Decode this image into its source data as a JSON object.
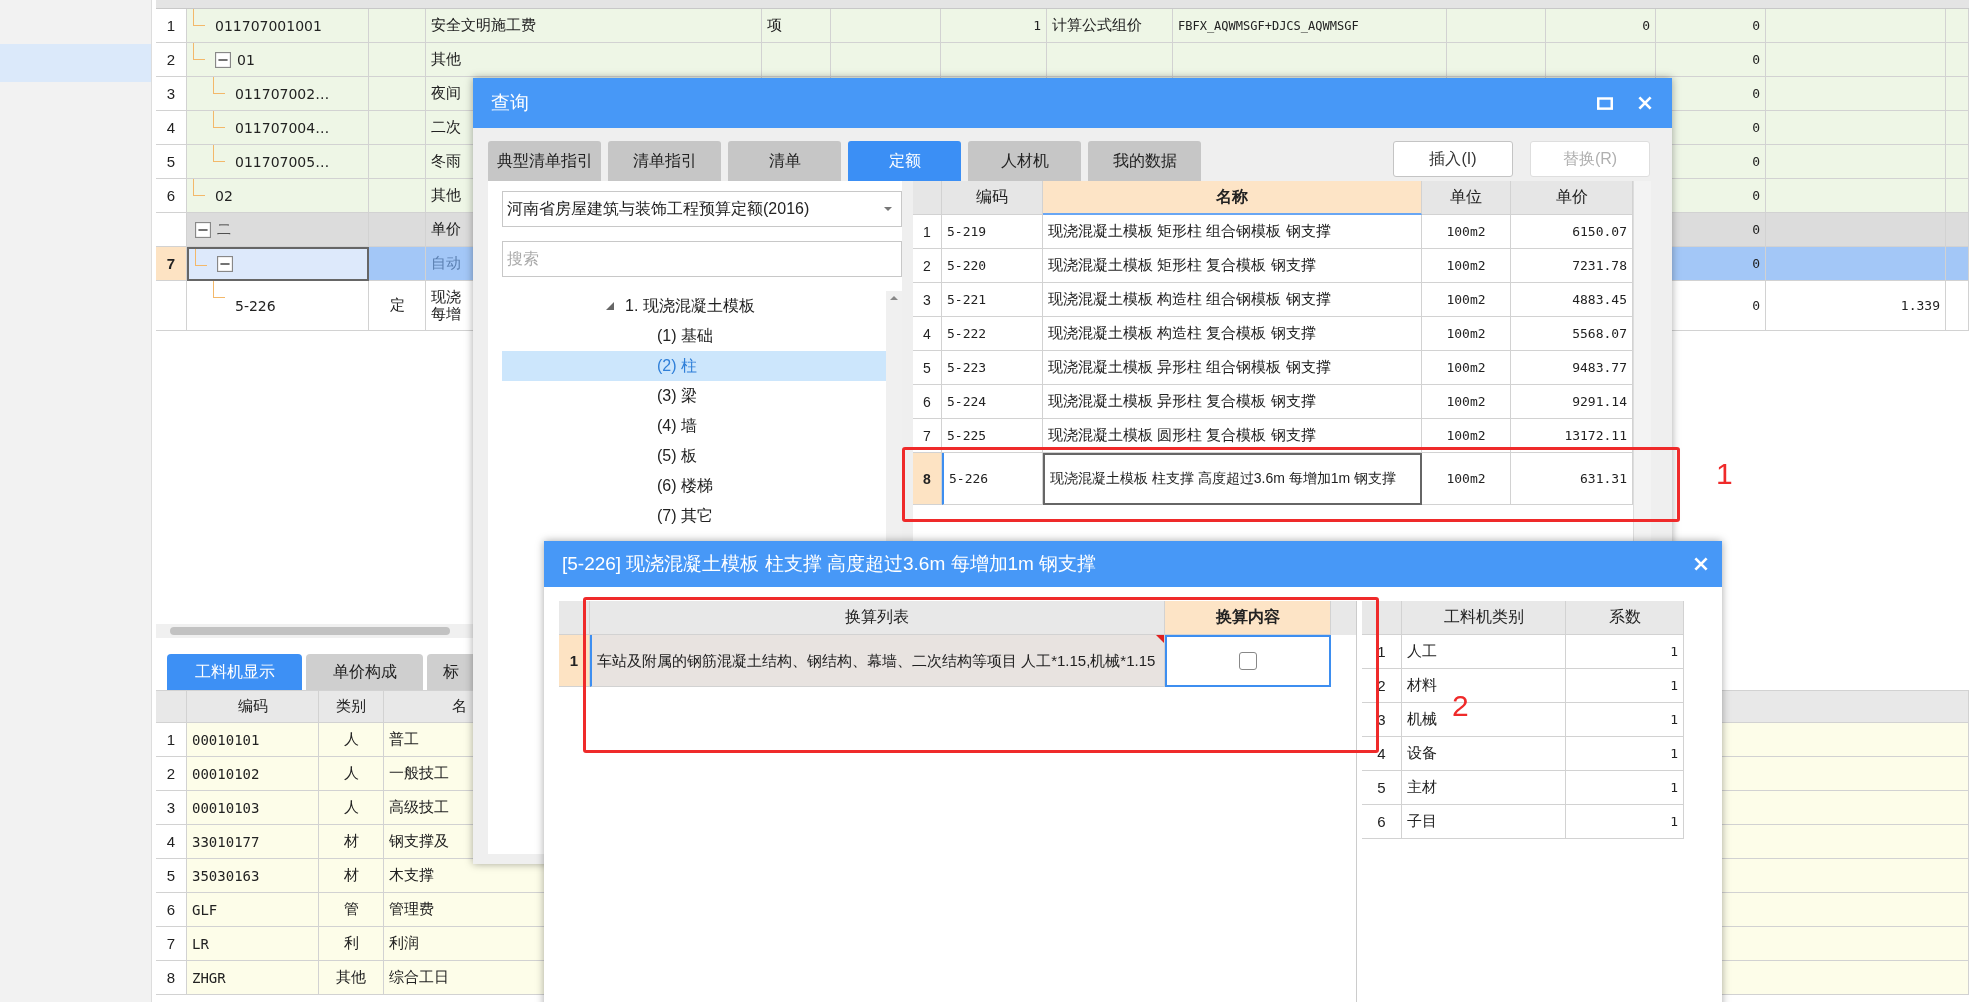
{
  "sidebar": {
    "items": [
      {
        "selected": true
      }
    ]
  },
  "main_table": {
    "rows": [
      {
        "kind": "measure",
        "number": "1",
        "code": "011707001001",
        "name": "安全文明施工费",
        "unit": "项",
        "quantity": "1",
        "method": "计算公式组价",
        "formula": "FBFX_AQWMSGF+DJCS_AQWMSGF",
        "value_1": "0",
        "value_2": "0"
      },
      {
        "kind": "measure",
        "number": "2",
        "code": "01",
        "expanded": true,
        "name": "其他",
        "value_2": "0",
        "children": [
          {
            "kind": "measure",
            "number": "3",
            "code": "011707002…",
            "name": "夜间",
            "value_2": "0"
          },
          {
            "kind": "measure",
            "number": "4",
            "code": "011707004…",
            "name": "二次",
            "value_2": "0"
          },
          {
            "kind": "measure",
            "number": "5",
            "code": "011707005…",
            "name": "冬雨",
            "value_2": "0"
          }
        ]
      },
      {
        "kind": "measure",
        "number": "6",
        "code": "02",
        "name": "其他",
        "value_2": "0"
      },
      {
        "kind": "section",
        "code": "二",
        "expanded": true,
        "name": "单价",
        "value_2": "0",
        "children": [
          {
            "kind": "measure",
            "number": "7",
            "selected": true,
            "expanded": true,
            "name": "自动",
            "value_2": "0",
            "children": [
              {
                "kind": "quota",
                "code": "5-226",
                "type": "定",
                "name": "现浇每增",
                "value_2": "0",
                "value_3": "1.339"
              }
            ]
          }
        ]
      }
    ]
  },
  "bottom_panel": {
    "tabs": [
      {
        "label": "工料机显示",
        "selected": true
      },
      {
        "label": "单价构成",
        "selected": false
      },
      {
        "label": "标",
        "selected": false
      }
    ],
    "columns": [
      "编码",
      "类别",
      "名"
    ],
    "rows": [
      {
        "number": "1",
        "code": "00010101",
        "type": "人",
        "name": "普工"
      },
      {
        "number": "2",
        "code": "00010102",
        "type": "人",
        "name": "一般技工"
      },
      {
        "number": "3",
        "code": "00010103",
        "type": "人",
        "name": "高级技工"
      },
      {
        "number": "4",
        "code": "33010177",
        "type": "材",
        "name": "钢支撑及"
      },
      {
        "number": "5",
        "code": "35030163",
        "type": "材",
        "name": "木支撑"
      },
      {
        "number": "6",
        "code": "GLF",
        "type": "管",
        "name": "管理费"
      },
      {
        "number": "7",
        "code": "LR",
        "type": "利",
        "name": "利润"
      },
      {
        "number": "8",
        "code": "ZHGR",
        "type": "其他",
        "name": "综合工日"
      }
    ]
  },
  "query_dialog": {
    "title": "查询",
    "tabs": [
      {
        "label": "典型清单指引",
        "selected": false
      },
      {
        "label": "清单指引",
        "selected": false
      },
      {
        "label": "清单",
        "selected": false
      },
      {
        "label": "定额",
        "selected": true
      },
      {
        "label": "人材机",
        "selected": false
      },
      {
        "label": "我的数据",
        "selected": false
      }
    ],
    "buttons": [
      {
        "label": "插入(I)",
        "disabled": false
      },
      {
        "label": "替换(R)",
        "disabled": true
      }
    ],
    "library": "河南省房屋建筑与装饰工程预算定额(2016)",
    "search": {
      "placeholder": "搜索"
    },
    "tree": {
      "label": "1. 现浇混凝土模板",
      "expanded": true,
      "children": [
        {
          "label": "(1) 基础",
          "selected": false
        },
        {
          "label": "(2) 柱",
          "selected": true
        },
        {
          "label": "(3) 梁",
          "selected": false
        },
        {
          "label": "(4) 墙",
          "selected": false
        },
        {
          "label": "(5) 板",
          "selected": false
        },
        {
          "label": "(6) 楼梯",
          "selected": false
        },
        {
          "label": "(7) 其它",
          "selected": false
        }
      ]
    },
    "columns": [
      {
        "label": "编码",
        "selected": false
      },
      {
        "label": "名称",
        "selected": true
      },
      {
        "label": "单位",
        "selected": false
      },
      {
        "label": "单价",
        "selected": false
      }
    ],
    "rows": [
      {
        "number": "1",
        "code": "5-219",
        "name": "现浇混凝土模板 矩形柱 组合钢模板 钢支撑",
        "unit": "100m2",
        "price": "6150.07",
        "selected": false
      },
      {
        "number": "2",
        "code": "5-220",
        "name": "现浇混凝土模板 矩形柱 复合模板 钢支撑",
        "unit": "100m2",
        "price": "7231.78",
        "selected": false
      },
      {
        "number": "3",
        "code": "5-221",
        "name": "现浇混凝土模板 构造柱 组合钢模板 钢支撑",
        "unit": "100m2",
        "price": "4883.45",
        "selected": false
      },
      {
        "number": "4",
        "code": "5-222",
        "name": "现浇混凝土模板 构造柱 复合模板 钢支撑",
        "unit": "100m2",
        "price": "5568.07",
        "selected": false
      },
      {
        "number": "5",
        "code": "5-223",
        "name": "现浇混凝土模板 异形柱 组合钢模板 钢支撑",
        "unit": "100m2",
        "price": "9483.77",
        "selected": false
      },
      {
        "number": "6",
        "code": "5-224",
        "name": "现浇混凝土模板 异形柱 复合模板 钢支撑",
        "unit": "100m2",
        "price": "9291.14",
        "selected": false
      },
      {
        "number": "7",
        "code": "5-225",
        "name": "现浇混凝土模板 圆形柱 复合模板 钢支撑",
        "unit": "100m2",
        "price": "13172.11",
        "selected": false
      },
      {
        "number": "8",
        "code": "5-226",
        "name": "现浇混凝土模板 柱支撑 高度超过3.6m 每增加1m 钢支撑",
        "unit": "100m2",
        "price": "631.31",
        "selected": true,
        "annotation": "1"
      }
    ]
  },
  "conversion_dialog": {
    "title": "[5-226] 现浇混凝土模板 柱支撑 高度超过3.6m 每增加1m 钢支撑",
    "columns": [
      {
        "label": "换算列表",
        "selected": false
      },
      {
        "label": "换算内容",
        "selected": true
      }
    ],
    "rows": [
      {
        "number": "1",
        "description": "车站及附属的钢筋混凝土结构、钢结构、幕墙、二次结构等项目 人工*1.15,机械*1.15",
        "checked": false
      }
    ],
    "annotation": "2",
    "category_columns": [
      "工料机类别",
      "系数"
    ],
    "categories": [
      {
        "number": "1",
        "category": "人工",
        "factor": "1"
      },
      {
        "number": "2",
        "category": "材料",
        "factor": "1"
      },
      {
        "number": "3",
        "category": "机械",
        "factor": "1"
      },
      {
        "number": "4",
        "category": "设备",
        "factor": "1"
      },
      {
        "number": "5",
        "category": "主材",
        "factor": "1"
      },
      {
        "number": "6",
        "category": "子目",
        "factor": "1"
      }
    ]
  }
}
